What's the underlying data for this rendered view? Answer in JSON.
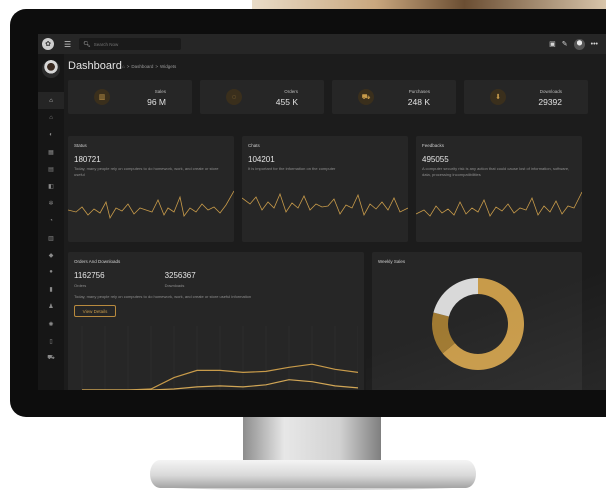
{
  "topbar": {
    "search_placeholder": "Search Now"
  },
  "sidebar": {
    "icons": [
      "home-icon",
      "bank-icon",
      "palette-icon",
      "grid-icon",
      "calendar-icon",
      "layers-icon",
      "settings-icon",
      "chart-icon",
      "table-icon",
      "pin-icon",
      "globe-icon",
      "building-icon",
      "user-icon",
      "gear-icon",
      "document-icon",
      "cart-icon"
    ]
  },
  "header": {
    "title": "Dashboard",
    "breadcrumb": [
      "Dashboard",
      "Widgets"
    ]
  },
  "stats": [
    {
      "label": "Sales",
      "value": "96 M",
      "icon": "bar-chart-icon"
    },
    {
      "label": "Orders",
      "value": "455 K",
      "icon": "circle-icon"
    },
    {
      "label": "Purchases",
      "value": "248 K",
      "icon": "cart-icon"
    },
    {
      "label": "Downloads",
      "value": "29392",
      "icon": "download-icon"
    }
  ],
  "cards": [
    {
      "title": "Status",
      "value": "180721",
      "desc": "Today, many people rely on computers to do homework, work, and create or store useful"
    },
    {
      "title": "Chats",
      "value": "104201",
      "desc": "It is important for the information on the computer"
    },
    {
      "title": "Feedbacks",
      "value": "495055",
      "desc": "A computer security risk is any action that could cause lost of information, software, data, processing incompatibilities"
    }
  ],
  "orders_downloads": {
    "title": "Orders And Downloads",
    "orders_value": "1162756",
    "orders_label": "Orders",
    "downloads_value": "3256367",
    "downloads_label": "Downloads",
    "desc": "Today, many people rely on computers to do homework, work, and create or store useful information",
    "button": "View Details"
  },
  "weekly_sales": {
    "title": "Weekly Sales"
  },
  "colors": {
    "accent": "#c89b4a",
    "panel": "#262626",
    "background": "#1c1c1c"
  },
  "chart_data": [
    {
      "type": "line",
      "title": "Orders And Downloads",
      "ylim": [
        0,
        300
      ],
      "series": [
        {
          "values": [
            0,
            0,
            0,
            5,
            60,
            95,
            95,
            85,
            90,
            110,
            125,
            100,
            85
          ]
        },
        {
          "values": [
            0,
            0,
            0,
            0,
            5,
            15,
            20,
            15,
            25,
            50,
            40,
            20,
            10
          ]
        }
      ],
      "grid": true
    },
    {
      "type": "pie",
      "title": "Weekly Sales",
      "values": [
        64,
        15,
        21
      ],
      "colors": [
        "#c89b4a",
        "#a07a32",
        "#d9d9d9"
      ]
    }
  ]
}
